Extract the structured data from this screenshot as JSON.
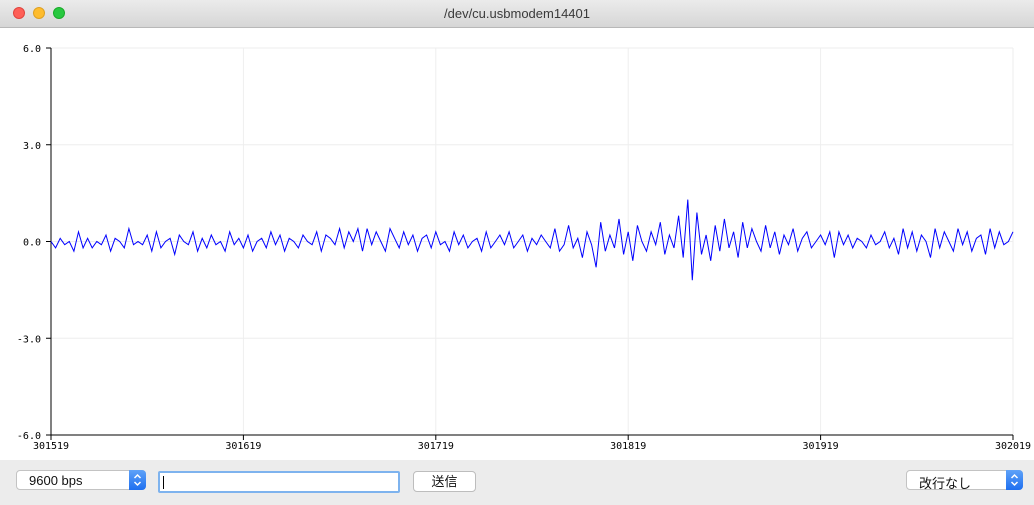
{
  "window": {
    "title": "/dev/cu.usbmodem14401"
  },
  "chart_data": {
    "type": "line",
    "y_ticks": [
      "6.0",
      "3.0",
      "0.0",
      "-3.0",
      "-6.0"
    ],
    "x_ticks": [
      "301519",
      "301619",
      "301719",
      "301819",
      "301919",
      "302019"
    ],
    "ylim": [
      -6.0,
      6.0
    ],
    "xlim": [
      301519,
      302019
    ],
    "grid": true,
    "series": [
      {
        "color": "#0000ff",
        "x_start": 301519,
        "x_step": 1,
        "values": [
          0.0,
          -0.2,
          0.1,
          -0.1,
          0.0,
          -0.3,
          0.3,
          -0.2,
          0.1,
          -0.2,
          0.0,
          -0.1,
          0.2,
          -0.3,
          0.1,
          0.0,
          -0.2,
          0.4,
          -0.1,
          0.0,
          -0.1,
          0.2,
          -0.3,
          0.3,
          -0.2,
          0.0,
          0.1,
          -0.4,
          0.2,
          0.0,
          -0.1,
          0.3,
          -0.3,
          0.1,
          -0.2,
          0.2,
          -0.1,
          0.0,
          -0.3,
          0.3,
          -0.1,
          0.1,
          -0.2,
          0.2,
          -0.3,
          0.0,
          0.1,
          -0.2,
          0.3,
          -0.1,
          0.2,
          -0.3,
          0.1,
          0.0,
          -0.2,
          0.2,
          0.0,
          -0.1,
          0.3,
          -0.3,
          0.2,
          0.1,
          -0.1,
          0.4,
          -0.2,
          0.3,
          0.0,
          0.4,
          -0.3,
          0.4,
          -0.1,
          0.3,
          0.0,
          -0.3,
          0.4,
          0.1,
          -0.2,
          0.3,
          -0.1,
          0.2,
          -0.3,
          0.1,
          0.2,
          -0.2,
          0.3,
          -0.1,
          0.0,
          -0.3,
          0.3,
          -0.1,
          0.2,
          -0.2,
          0.0,
          0.1,
          -0.3,
          0.3,
          -0.2,
          0.0,
          0.2,
          -0.1,
          0.3,
          -0.2,
          0.0,
          0.2,
          -0.3,
          0.1,
          -0.1,
          0.2,
          0.0,
          -0.2,
          0.4,
          -0.3,
          -0.1,
          0.5,
          -0.2,
          0.1,
          -0.5,
          0.3,
          -0.1,
          -0.8,
          0.6,
          -0.3,
          0.2,
          -0.2,
          0.7,
          -0.4,
          0.3,
          -0.6,
          0.5,
          0.0,
          -0.3,
          0.3,
          -0.1,
          0.6,
          -0.4,
          0.2,
          -0.2,
          0.8,
          -0.5,
          1.3,
          -1.2,
          0.9,
          -0.4,
          0.2,
          -0.6,
          0.5,
          -0.3,
          0.7,
          -0.2,
          0.3,
          -0.5,
          0.6,
          -0.2,
          0.4,
          0.0,
          -0.3,
          0.5,
          -0.2,
          0.3,
          -0.4,
          0.2,
          -0.1,
          0.4,
          -0.3,
          0.1,
          0.3,
          -0.2,
          0.0,
          0.2,
          -0.1,
          0.3,
          -0.5,
          0.3,
          -0.1,
          0.2,
          -0.2,
          0.1,
          0.0,
          -0.2,
          0.2,
          -0.1,
          0.0,
          0.3,
          -0.2,
          0.1,
          -0.4,
          0.4,
          -0.2,
          0.3,
          -0.3,
          0.2,
          0.0,
          -0.5,
          0.4,
          -0.2,
          0.3,
          0.0,
          -0.3,
          0.4,
          -0.1,
          0.3,
          -0.3,
          0.1,
          0.2,
          -0.4,
          0.4,
          -0.2,
          0.3,
          -0.1,
          0.0,
          0.3
        ]
      }
    ]
  },
  "controls": {
    "baud_select": "9600 bps",
    "send_input": {
      "value": "",
      "placeholder": ""
    },
    "send_button": "送信",
    "line_ending_select": "改行なし"
  }
}
